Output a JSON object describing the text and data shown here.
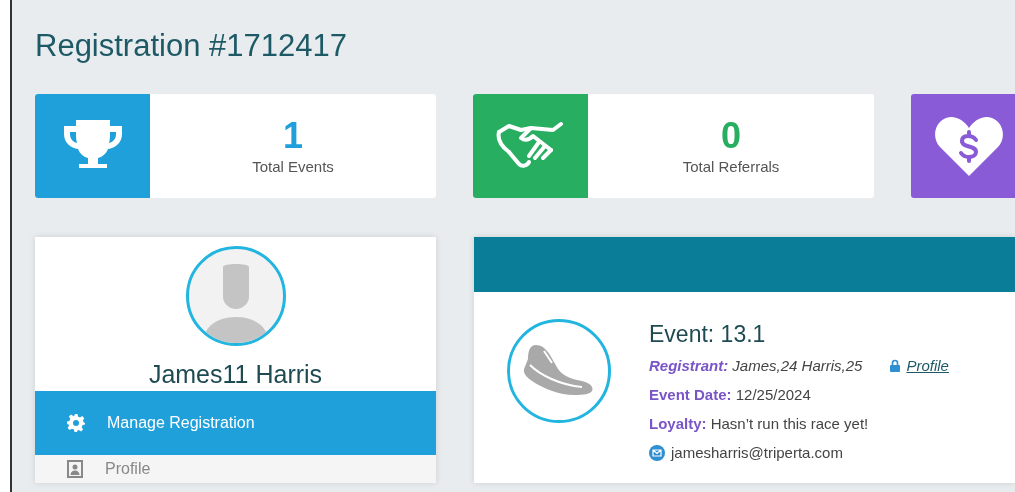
{
  "title": "Registration #1712417",
  "stats": [
    {
      "kind": "trophy",
      "color": "#1fa0db",
      "value": "1",
      "label": "Total Events"
    },
    {
      "kind": "handshake",
      "color": "#27ae60",
      "value": "0",
      "label": "Total Referrals"
    },
    {
      "kind": "donation",
      "color": "#8a5bd6"
    }
  ],
  "profile": {
    "name": "James11 Harris",
    "menu": [
      {
        "kind": "settings",
        "label": "Manage Registration",
        "selected": true
      },
      {
        "kind": "profile",
        "label": "Profile",
        "selected": false
      }
    ]
  },
  "event": {
    "title": "Event: 13.1",
    "registrant_label": "Registrant:",
    "registrant": "James,24 Harris,25",
    "profile_link": "Profile",
    "fields": [
      {
        "label": "Event Date:",
        "value": "12/25/2024"
      },
      {
        "label": "Loyalty:",
        "value": "Hasn’t run this race yet!"
      }
    ],
    "email": "jamesharris@triperta.com"
  }
}
